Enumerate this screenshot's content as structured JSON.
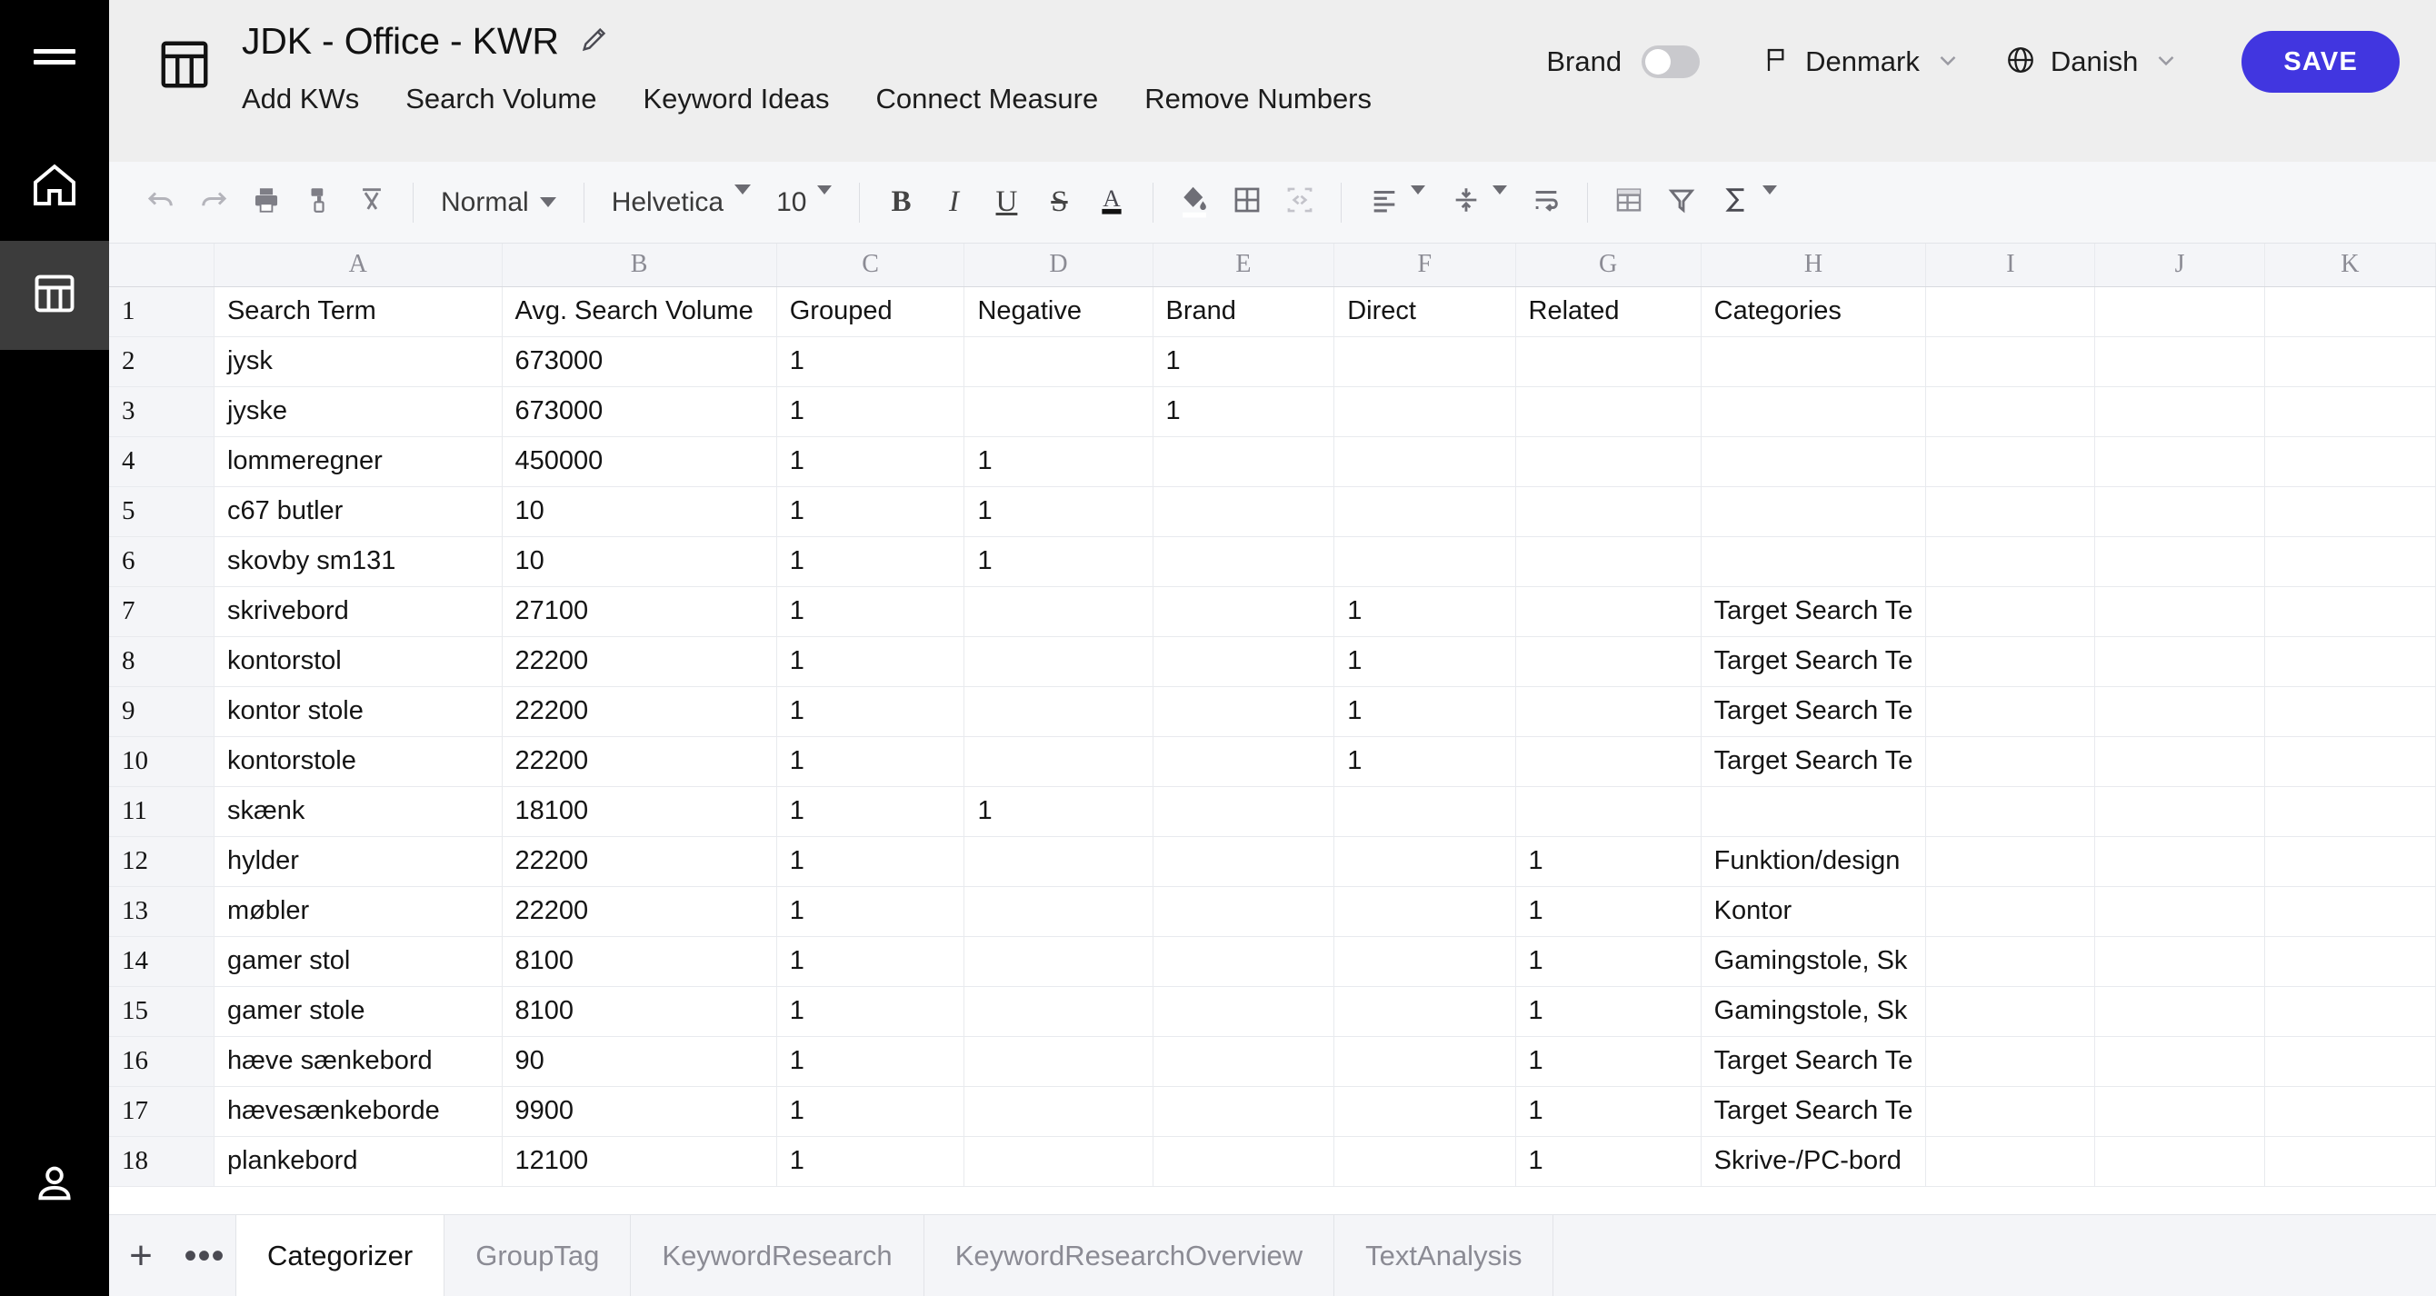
{
  "sidebar": {
    "items": [
      {
        "name": "menu-toggle",
        "icon": "hamburger-icon"
      },
      {
        "name": "home",
        "icon": "home-icon"
      },
      {
        "name": "spreadsheets",
        "icon": "spreadsheet-icon",
        "active": true
      },
      {
        "name": "account",
        "icon": "person-icon"
      }
    ]
  },
  "header": {
    "doc_icon": "spreadsheet-icon",
    "title": "JDK - Office - KWR",
    "edit_icon": "pencil-icon",
    "menu": [
      "Add KWs",
      "Search Volume",
      "Keyword Ideas",
      "Connect Measure",
      "Remove Numbers"
    ],
    "brand_label": "Brand",
    "brand_toggle_on": false,
    "country": "Denmark",
    "country_icon": "flag-icon",
    "language": "Danish",
    "language_icon": "globe-icon",
    "save_label": "SAVE",
    "accent_color": "#4136e0"
  },
  "toolbar": {
    "undo_icon": "undo-icon",
    "redo_icon": "redo-icon",
    "print_icon": "print-icon",
    "paint_format_icon": "paint-format-icon",
    "clear_format_icon": "clear-format-icon",
    "style_value": "Normal",
    "font_value": "Helvetica",
    "size_value": "10",
    "bold_label": "B",
    "italic_label": "I",
    "underline_label": "U",
    "strikethrough_label": "S",
    "text_color_label": "A",
    "fill_color_icon": "fill-color-icon",
    "borders_icon": "borders-icon",
    "merge_cells_icon": "merge-cells-icon",
    "halign_icon": "horizontal-align-icon",
    "valign_icon": "vertical-align-icon",
    "wrap_icon": "text-wrap-icon",
    "freeze_icon": "freeze-panes-icon",
    "filter_icon": "filter-icon",
    "functions_icon": "sum-icon"
  },
  "grid": {
    "column_letters": [
      "A",
      "B",
      "C",
      "D",
      "E",
      "F",
      "G",
      "H",
      "I",
      "J",
      "K"
    ],
    "rows": [
      {
        "n": "1",
        "cells": [
          "Search Term",
          "Avg. Search Volume",
          "Grouped",
          "Negative",
          "Brand",
          "Direct",
          "Related",
          "Categories",
          "",
          "",
          ""
        ]
      },
      {
        "n": "2",
        "cells": [
          "jysk",
          "673000",
          "1",
          "",
          "1",
          "",
          "",
          "",
          "",
          "",
          ""
        ]
      },
      {
        "n": "3",
        "cells": [
          "jyske",
          "673000",
          "1",
          "",
          "1",
          "",
          "",
          "",
          "",
          "",
          ""
        ]
      },
      {
        "n": "4",
        "cells": [
          "lommeregner",
          "450000",
          "1",
          "1",
          "",
          "",
          "",
          "",
          "",
          "",
          ""
        ]
      },
      {
        "n": "5",
        "cells": [
          "c67 butler",
          "10",
          "1",
          "1",
          "",
          "",
          "",
          "",
          "",
          "",
          ""
        ]
      },
      {
        "n": "6",
        "cells": [
          "skovby sm131",
          "10",
          "1",
          "1",
          "",
          "",
          "",
          "",
          "",
          "",
          ""
        ]
      },
      {
        "n": "7",
        "cells": [
          "skrivebord",
          "27100",
          "1",
          "",
          "",
          "1",
          "",
          "Target Search Te",
          "",
          "",
          ""
        ]
      },
      {
        "n": "8",
        "cells": [
          "kontorstol",
          "22200",
          "1",
          "",
          "",
          "1",
          "",
          "Target Search Te",
          "",
          "",
          ""
        ]
      },
      {
        "n": "9",
        "cells": [
          "kontor stole",
          "22200",
          "1",
          "",
          "",
          "1",
          "",
          "Target Search Te",
          "",
          "",
          ""
        ]
      },
      {
        "n": "10",
        "cells": [
          "kontorstole",
          "22200",
          "1",
          "",
          "",
          "1",
          "",
          "Target Search Te",
          "",
          "",
          ""
        ]
      },
      {
        "n": "11",
        "cells": [
          "skænk",
          "18100",
          "1",
          "1",
          "",
          "",
          "",
          "",
          "",
          "",
          ""
        ]
      },
      {
        "n": "12",
        "cells": [
          "hylder",
          "22200",
          "1",
          "",
          "",
          "",
          "1",
          "Funktion/design",
          "",
          "",
          ""
        ]
      },
      {
        "n": "13",
        "cells": [
          "møbler",
          "22200",
          "1",
          "",
          "",
          "",
          "1",
          "Kontor",
          "",
          "",
          ""
        ]
      },
      {
        "n": "14",
        "cells": [
          "gamer stol",
          "8100",
          "1",
          "",
          "",
          "",
          "1",
          "Gamingstole, Sk",
          "",
          "",
          ""
        ]
      },
      {
        "n": "15",
        "cells": [
          "gamer stole",
          "8100",
          "1",
          "",
          "",
          "",
          "1",
          "Gamingstole, Sk",
          "",
          "",
          ""
        ]
      },
      {
        "n": "16",
        "cells": [
          "hæve sænkebord",
          "90",
          "1",
          "",
          "",
          "",
          "1",
          "Target Search Te",
          "",
          "",
          ""
        ]
      },
      {
        "n": "17",
        "cells": [
          "hævesænkeborde",
          "9900",
          "1",
          "",
          "",
          "",
          "1",
          "Target Search Te",
          "",
          "",
          ""
        ]
      },
      {
        "n": "18",
        "cells": [
          "plankebord",
          "12100",
          "1",
          "",
          "",
          "",
          "1",
          "Skrive-/PC-bord",
          "",
          "",
          ""
        ]
      }
    ]
  },
  "tabbar": {
    "add_label": "+",
    "more_label": "•••",
    "tabs": [
      {
        "label": "Categorizer",
        "active": true
      },
      {
        "label": "GroupTag",
        "active": false
      },
      {
        "label": "KeywordResearch",
        "active": false
      },
      {
        "label": "KeywordResearchOverview",
        "active": false
      },
      {
        "label": "TextAnalysis",
        "active": false
      }
    ]
  }
}
